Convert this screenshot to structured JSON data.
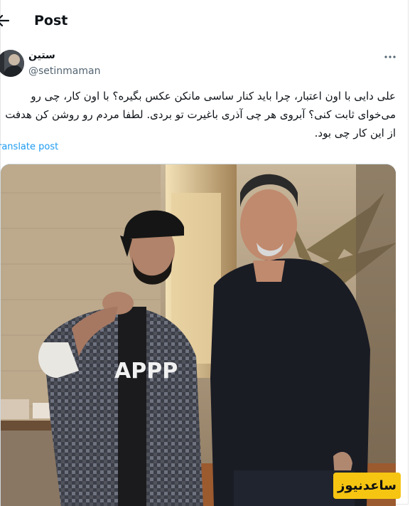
{
  "header": {
    "title": "Post",
    "back_icon": "arrow-left-icon"
  },
  "author": {
    "display_name": "ستین",
    "handle": "@setinmaman"
  },
  "tweet": {
    "lines": [
      "علی دایی با اون اعتبار، چرا باید کنار ساسی مانکن عکس بگیره؟ با اون کار، چی رو",
      "می‌خوای ثابت کنی؟ آبروی هر چی آذری باغیرت تو بردی. لطفا مردم رو روشن کن هدفت",
      "از این کار چی بود."
    ],
    "translate_label": "ranslate post"
  },
  "media": {
    "shirt_print": "APPP"
  },
  "watermark": {
    "text": "ساعدنیوز"
  },
  "colors": {
    "link": "#1d9bf0",
    "handle": "#536471",
    "watermark_bg": "#f6c512"
  }
}
